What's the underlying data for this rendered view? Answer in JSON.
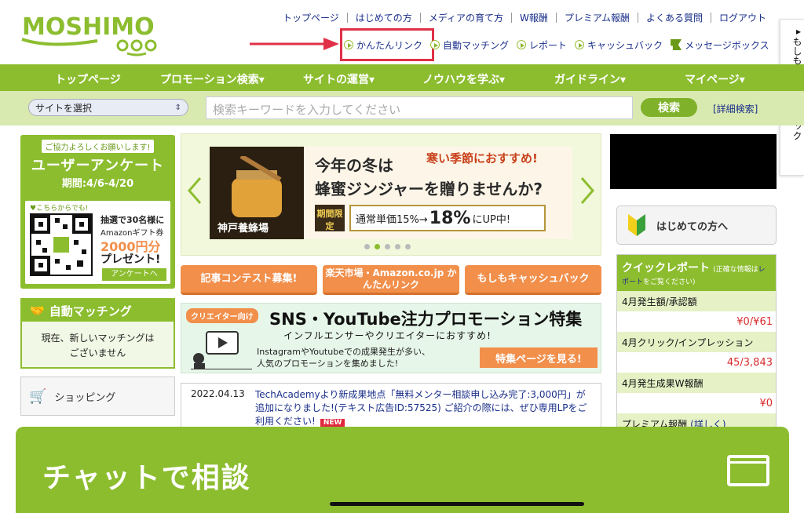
{
  "logo": {
    "text": "MOSHIMO"
  },
  "top_links": [
    "トップページ",
    "はじめての方",
    "メディアの育て方",
    "W報酬",
    "プレミアム報酬",
    "よくある質問",
    "ログアウト"
  ],
  "quick_links": [
    "かんたんリンク",
    "自動マッチング",
    "レポート",
    "キャッシュバック",
    "メッセージボックス"
  ],
  "side_tab": "もしもキャッシュバック",
  "nav": [
    "トップページ",
    "プロモーション検索▾",
    "サイトの運営▾",
    "ノウハウを学ぶ▾",
    "ガイドライン▾",
    "マイページ▾"
  ],
  "search": {
    "site_select": "サイトを選択",
    "placeholder": "検索キーワードを入力してください",
    "button": "検索",
    "advanced": "[詳細検索]"
  },
  "survey": {
    "note": "ご協力よろしくお願いします!",
    "title": "ユーザーアンケート",
    "period": "期間:4/6-4/20",
    "from_here": "♥こちらからでも!",
    "lottery": "抽選で30名様に",
    "gift": "Amazonギフト券",
    "amount": "2000円分",
    "present": "プレゼント!",
    "button": "アンケートへ"
  },
  "auto_matching": {
    "title": "自動マッチング",
    "body_line1": "現在、新しいマッチングは",
    "body_line2": "ございません"
  },
  "shopping": "ショッピング",
  "banner": {
    "season": "寒い季節におすすめ!",
    "line1": "今年の冬は",
    "line2": "蜂蜜ジンジャーを贈りませんか?",
    "limited": "期間限定",
    "offer_prefix": "通常単価15%→",
    "offer_big": "18%",
    "offer_suffix": "にUP中!",
    "shop_name": "神戸養蜂場"
  },
  "orange_buttons": [
    "記事コンテスト募集!",
    "楽天市場・Amazon.co.jp かんたんリンク",
    "もしもキャッシュバック"
  ],
  "sns_banner": {
    "tag": "クリエイター向け",
    "title": "SNS・YouTube注力プロモーション特集",
    "sub": "インフルエンサーやクリエイターにおすすめ!",
    "desc1": "InstagramやYoutubeでの成果発生が多い、",
    "desc2": "人気のプロモーションを集めました!",
    "cta": "特集ページを見る!"
  },
  "news": {
    "date": "2022.04.13",
    "text": "TechAcademyより新成果地点「無料メンター相談申し込み完了:3,000円」が追加になりました!(テキスト広告ID:57525) ご紹介の際には、ぜひ専用LPをご利用ください!",
    "badge": "NEW"
  },
  "first_time": "はじめての方へ",
  "quick_report": {
    "title": "クイックレポート",
    "note_a": "(正確な情報は",
    "note_link": "レポート",
    "note_b": "をご覧ください)",
    "rows": [
      {
        "label": "4月発生額/承認額",
        "value": "¥0/¥61"
      },
      {
        "label": "4月クリック/インプレッション",
        "value": "45/3,843"
      },
      {
        "label": "4月発生成果W報酬",
        "value": "¥0"
      }
    ],
    "premium": "プレミアム報酬",
    "premium_link": "(詳しく)"
  },
  "chat": {
    "label": "チャットで相談"
  },
  "colors": {
    "brand_green": "#8cbd2f",
    "orange": "#f18f4b",
    "highlight_red": "#e03047",
    "link_blue": "#1a2f8a"
  }
}
